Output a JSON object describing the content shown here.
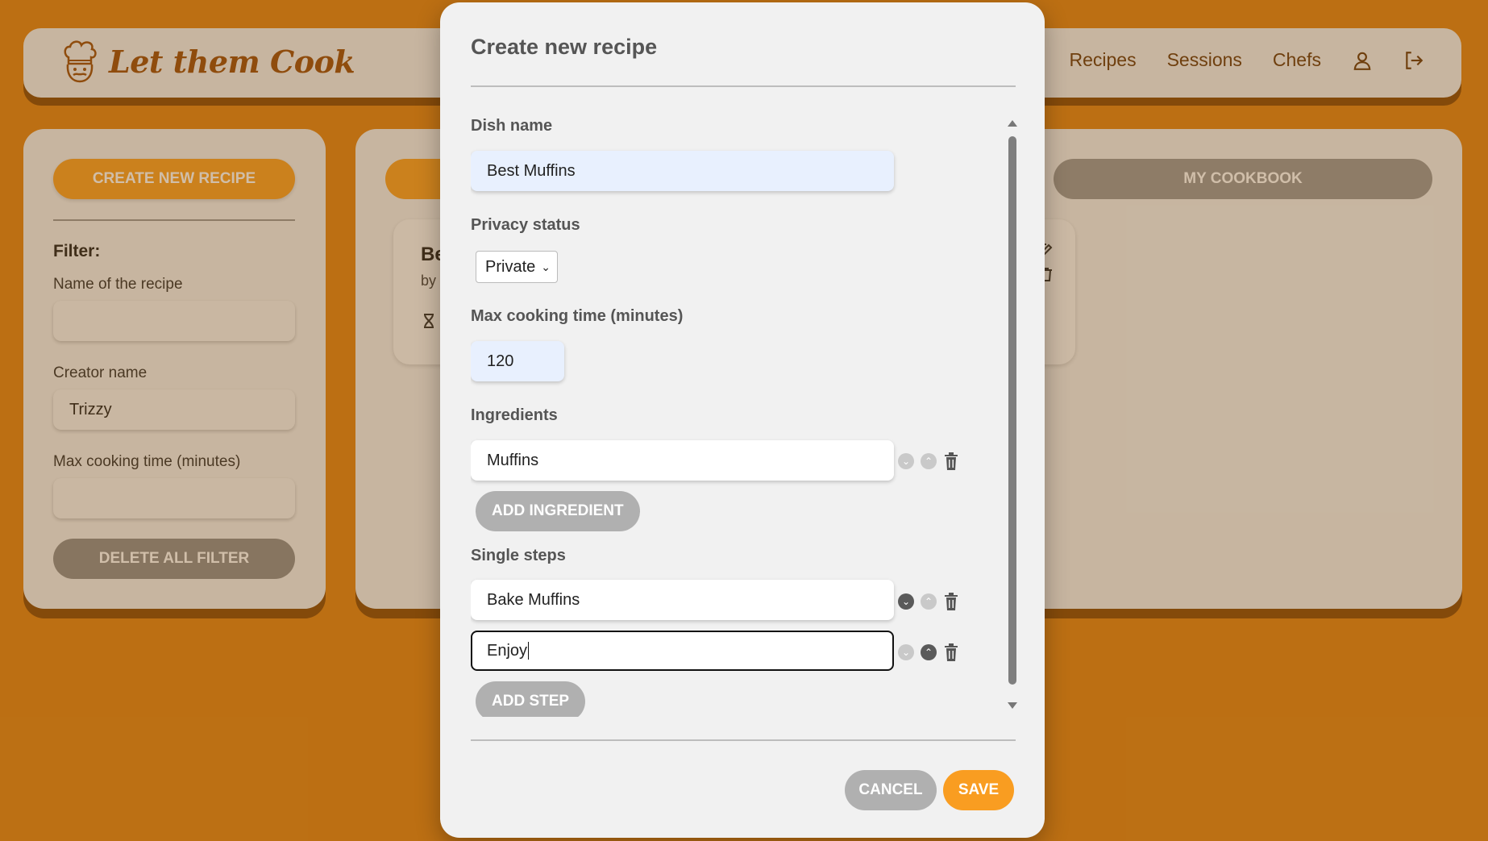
{
  "app": {
    "brand": "Let them Cook",
    "nav": {
      "partial_link": "e",
      "recipes": "Recipes",
      "sessions": "Sessions",
      "chefs": "Chefs",
      "profile_icon": "user-icon",
      "logout_icon": "logout-icon"
    }
  },
  "sidebar": {
    "create_button": "CREATE NEW RECIPE",
    "filter_title": "Filter:",
    "name_label": "Name of the recipe",
    "name_value": "",
    "creator_label": "Creator name",
    "creator_value": "Trizzy",
    "time_label": "Max cooking time (minutes)",
    "time_value": "",
    "delete_button": "DELETE ALL FILTER"
  },
  "main": {
    "tab_cookbook": "MY COOKBOOK",
    "card": {
      "title_partial": "Be",
      "by_partial": "by",
      "hourglass_icon": "hourglass-icon",
      "edit_icon": "edit-icon",
      "trash_icon": "trash-icon"
    }
  },
  "modal": {
    "title": "Create new recipe",
    "dish_name_label": "Dish name",
    "dish_name_value": "Best Muffins",
    "privacy_label": "Privacy status",
    "privacy_value": "Private",
    "max_time_label": "Max cooking time (minutes)",
    "max_time_value": "120",
    "ingredients_label": "Ingredients",
    "ingredients": [
      "Muffins"
    ],
    "add_ingredient": "ADD INGREDIENT",
    "steps_label": "Single steps",
    "steps": [
      "Bake Muffins",
      "Enjoy"
    ],
    "add_step": "ADD STEP",
    "cancel": "CANCEL",
    "save": "SAVE"
  },
  "colors": {
    "background": "#e0861a",
    "accent": "#f7a128",
    "brand_text": "#9c5110"
  }
}
